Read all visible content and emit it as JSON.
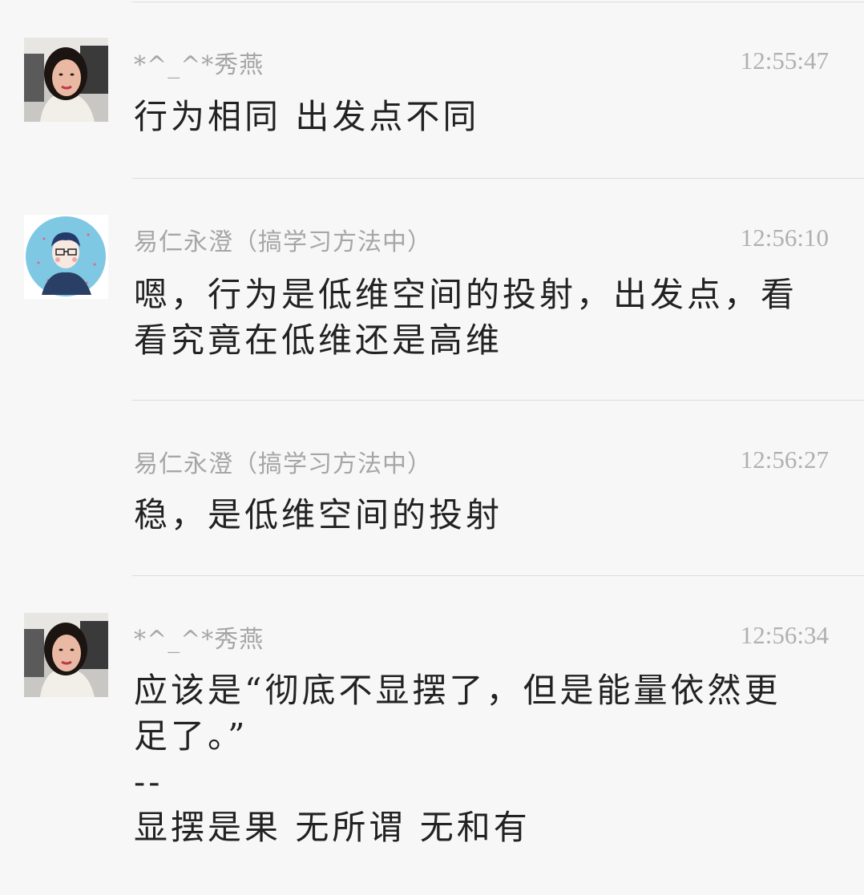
{
  "messages": [
    {
      "sender": "*^_^*秀燕",
      "time": "12:55:47",
      "avatar": "woman-photo-avatar",
      "lines": [
        "行为相同 出发点不同"
      ]
    },
    {
      "sender": "易仁永澄（搞学习方法中）",
      "time": "12:56:10",
      "avatar": "illustrated-man-avatar",
      "lines": [
        "嗯，行为是低维空间的投射，出发点，看",
        "看究竟在低维还是高维"
      ]
    },
    {
      "sender": "易仁永澄（搞学习方法中）",
      "time": "12:56:27",
      "lines": [
        "稳，是低维空间的投射"
      ]
    },
    {
      "sender": "*^_^*秀燕",
      "time": "12:56:34",
      "avatar": "woman-photo-avatar",
      "lines": [
        "应该是“彻底不显摆了，但是能量依然更",
        "足了。”",
        "--",
        "显摆是果 无所谓 无和有"
      ]
    }
  ],
  "colors": {
    "background": "#f7f7f7",
    "divider": "#dcdcdc",
    "sender": "#a6a6a6",
    "time": "#b0b0b0",
    "text": "#222222"
  }
}
